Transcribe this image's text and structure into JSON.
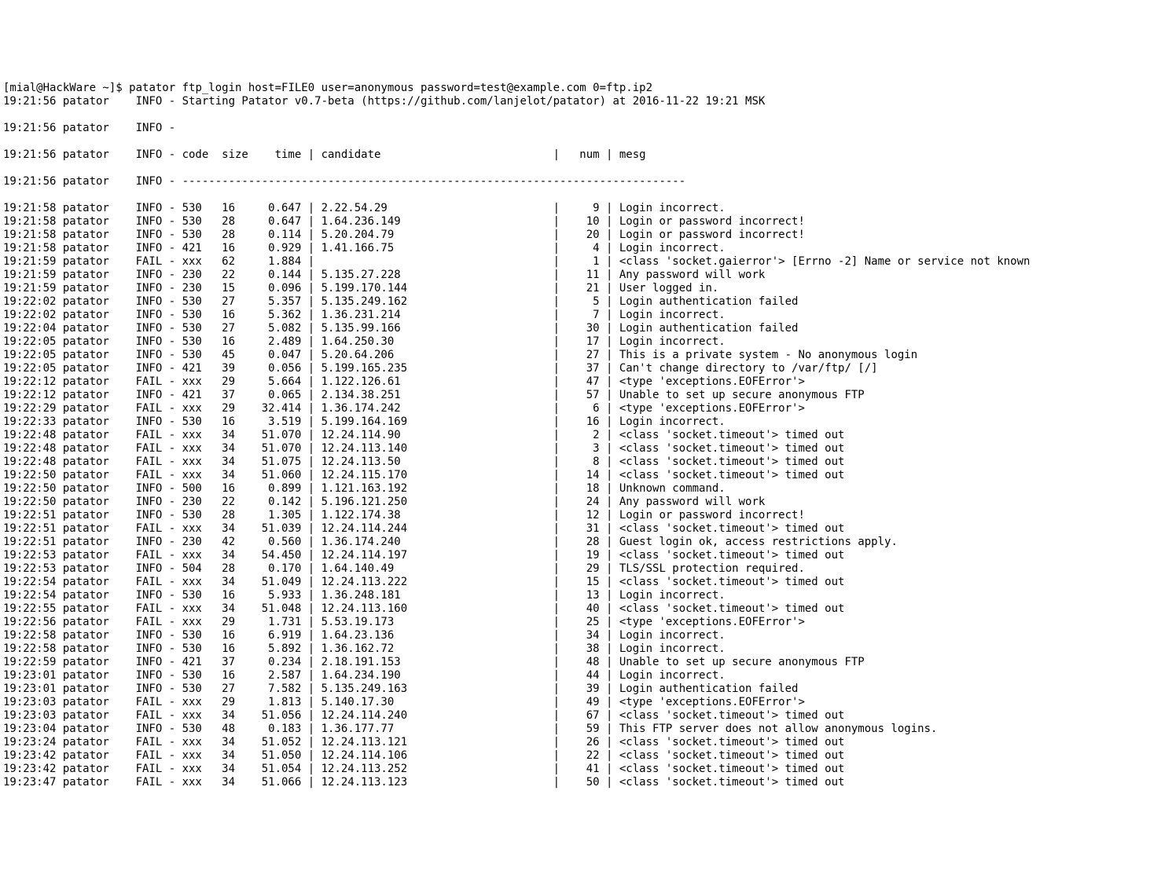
{
  "prompt": "[mial@HackWare ~]$ ",
  "command": "patator ftp_login host=FILE0 user=anonymous password=test@example.com 0=ftp.ip2",
  "startup_line": "19:21:56 patator    INFO - Starting Patator v0.7-beta (https://github.com/lanjelot/patator) at 2016-11-22 19:21 MSK",
  "blank_line": "19:21:56 patator    INFO -",
  "header_line": "19:21:56 patator    INFO - code  size    time | candidate                          |   num | mesg",
  "divider_line": "19:21:56 patator    INFO - ----------------------------------------------------------------------------",
  "rows": [
    {
      "ts": "19:21:58",
      "lvl": "INFO",
      "code": "530",
      "size": "16",
      "time": "0.647",
      "cand": "2.22.54.29",
      "num": "9",
      "mesg": "Login incorrect."
    },
    {
      "ts": "19:21:58",
      "lvl": "INFO",
      "code": "530",
      "size": "28",
      "time": "0.647",
      "cand": "1.64.236.149",
      "num": "10",
      "mesg": "Login or password incorrect!"
    },
    {
      "ts": "19:21:58",
      "lvl": "INFO",
      "code": "530",
      "size": "28",
      "time": "0.114",
      "cand": "5.20.204.79",
      "num": "20",
      "mesg": "Login or password incorrect!"
    },
    {
      "ts": "19:21:58",
      "lvl": "INFO",
      "code": "421",
      "size": "16",
      "time": "0.929",
      "cand": "1.41.166.75",
      "num": "4",
      "mesg": "Login incorrect."
    },
    {
      "ts": "19:21:59",
      "lvl": "FAIL",
      "code": "xxx",
      "size": "62",
      "time": "1.884",
      "cand": "",
      "num": "1",
      "mesg": "<class 'socket.gaierror'> [Errno -2] Name or service not known"
    },
    {
      "ts": "19:21:59",
      "lvl": "INFO",
      "code": "230",
      "size": "22",
      "time": "0.144",
      "cand": "5.135.27.228",
      "num": "11",
      "mesg": "Any password will work"
    },
    {
      "ts": "19:21:59",
      "lvl": "INFO",
      "code": "230",
      "size": "15",
      "time": "0.096",
      "cand": "5.199.170.144",
      "num": "21",
      "mesg": "User logged in."
    },
    {
      "ts": "19:22:02",
      "lvl": "INFO",
      "code": "530",
      "size": "27",
      "time": "5.357",
      "cand": "5.135.249.162",
      "num": "5",
      "mesg": "Login authentication failed"
    },
    {
      "ts": "19:22:02",
      "lvl": "INFO",
      "code": "530",
      "size": "16",
      "time": "5.362",
      "cand": "1.36.231.214",
      "num": "7",
      "mesg": "Login incorrect."
    },
    {
      "ts": "19:22:04",
      "lvl": "INFO",
      "code": "530",
      "size": "27",
      "time": "5.082",
      "cand": "5.135.99.166",
      "num": "30",
      "mesg": "Login authentication failed"
    },
    {
      "ts": "19:22:05",
      "lvl": "INFO",
      "code": "530",
      "size": "16",
      "time": "2.489",
      "cand": "1.64.250.30",
      "num": "17",
      "mesg": "Login incorrect."
    },
    {
      "ts": "19:22:05",
      "lvl": "INFO",
      "code": "530",
      "size": "45",
      "time": "0.047",
      "cand": "5.20.64.206",
      "num": "27",
      "mesg": "This is a private system - No anonymous login"
    },
    {
      "ts": "19:22:05",
      "lvl": "INFO",
      "code": "421",
      "size": "39",
      "time": "0.056",
      "cand": "5.199.165.235",
      "num": "37",
      "mesg": "Can't change directory to /var/ftp/ [/]"
    },
    {
      "ts": "19:22:12",
      "lvl": "FAIL",
      "code": "xxx",
      "size": "29",
      "time": "5.664",
      "cand": "1.122.126.61",
      "num": "47",
      "mesg": "<type 'exceptions.EOFError'>"
    },
    {
      "ts": "19:22:12",
      "lvl": "INFO",
      "code": "421",
      "size": "37",
      "time": "0.065",
      "cand": "2.134.38.251",
      "num": "57",
      "mesg": "Unable to set up secure anonymous FTP"
    },
    {
      "ts": "19:22:29",
      "lvl": "FAIL",
      "code": "xxx",
      "size": "29",
      "time": "32.414",
      "cand": "1.36.174.242",
      "num": "6",
      "mesg": "<type 'exceptions.EOFError'>"
    },
    {
      "ts": "19:22:33",
      "lvl": "INFO",
      "code": "530",
      "size": "16",
      "time": "3.519",
      "cand": "5.199.164.169",
      "num": "16",
      "mesg": "Login incorrect."
    },
    {
      "ts": "19:22:48",
      "lvl": "FAIL",
      "code": "xxx",
      "size": "34",
      "time": "51.070",
      "cand": "12.24.114.90",
      "num": "2",
      "mesg": "<class 'socket.timeout'> timed out"
    },
    {
      "ts": "19:22:48",
      "lvl": "FAIL",
      "code": "xxx",
      "size": "34",
      "time": "51.070",
      "cand": "12.24.113.140",
      "num": "3",
      "mesg": "<class 'socket.timeout'> timed out"
    },
    {
      "ts": "19:22:48",
      "lvl": "FAIL",
      "code": "xxx",
      "size": "34",
      "time": "51.075",
      "cand": "12.24.113.50",
      "num": "8",
      "mesg": "<class 'socket.timeout'> timed out"
    },
    {
      "ts": "19:22:50",
      "lvl": "FAIL",
      "code": "xxx",
      "size": "34",
      "time": "51.060",
      "cand": "12.24.115.170",
      "num": "14",
      "mesg": "<class 'socket.timeout'> timed out"
    },
    {
      "ts": "19:22:50",
      "lvl": "INFO",
      "code": "500",
      "size": "16",
      "time": "0.899",
      "cand": "1.121.163.192",
      "num": "18",
      "mesg": "Unknown command."
    },
    {
      "ts": "19:22:50",
      "lvl": "INFO",
      "code": "230",
      "size": "22",
      "time": "0.142",
      "cand": "5.196.121.250",
      "num": "24",
      "mesg": "Any password will work"
    },
    {
      "ts": "19:22:51",
      "lvl": "INFO",
      "code": "530",
      "size": "28",
      "time": "1.305",
      "cand": "1.122.174.38",
      "num": "12",
      "mesg": "Login or password incorrect!"
    },
    {
      "ts": "19:22:51",
      "lvl": "FAIL",
      "code": "xxx",
      "size": "34",
      "time": "51.039",
      "cand": "12.24.114.244",
      "num": "31",
      "mesg": "<class 'socket.timeout'> timed out"
    },
    {
      "ts": "19:22:51",
      "lvl": "INFO",
      "code": "230",
      "size": "42",
      "time": "0.560",
      "cand": "1.36.174.240",
      "num": "28",
      "mesg": "Guest login ok, access restrictions apply."
    },
    {
      "ts": "19:22:53",
      "lvl": "FAIL",
      "code": "xxx",
      "size": "34",
      "time": "54.450",
      "cand": "12.24.114.197",
      "num": "19",
      "mesg": "<class 'socket.timeout'> timed out"
    },
    {
      "ts": "19:22:53",
      "lvl": "INFO",
      "code": "504",
      "size": "28",
      "time": "0.170",
      "cand": "1.64.140.49",
      "num": "29",
      "mesg": "TLS/SSL protection required."
    },
    {
      "ts": "19:22:54",
      "lvl": "FAIL",
      "code": "xxx",
      "size": "34",
      "time": "51.049",
      "cand": "12.24.113.222",
      "num": "15",
      "mesg": "<class 'socket.timeout'> timed out"
    },
    {
      "ts": "19:22:54",
      "lvl": "INFO",
      "code": "530",
      "size": "16",
      "time": "5.933",
      "cand": "1.36.248.181",
      "num": "13",
      "mesg": "Login incorrect."
    },
    {
      "ts": "19:22:55",
      "lvl": "FAIL",
      "code": "xxx",
      "size": "34",
      "time": "51.048",
      "cand": "12.24.113.160",
      "num": "40",
      "mesg": "<class 'socket.timeout'> timed out"
    },
    {
      "ts": "19:22:56",
      "lvl": "FAIL",
      "code": "xxx",
      "size": "29",
      "time": "1.731",
      "cand": "5.53.19.173",
      "num": "25",
      "mesg": "<type 'exceptions.EOFError'>"
    },
    {
      "ts": "19:22:58",
      "lvl": "INFO",
      "code": "530",
      "size": "16",
      "time": "6.919",
      "cand": "1.64.23.136",
      "num": "34",
      "mesg": "Login incorrect."
    },
    {
      "ts": "19:22:58",
      "lvl": "INFO",
      "code": "530",
      "size": "16",
      "time": "5.892",
      "cand": "1.36.162.72",
      "num": "38",
      "mesg": "Login incorrect."
    },
    {
      "ts": "19:22:59",
      "lvl": "INFO",
      "code": "421",
      "size": "37",
      "time": "0.234",
      "cand": "2.18.191.153",
      "num": "48",
      "mesg": "Unable to set up secure anonymous FTP"
    },
    {
      "ts": "19:23:01",
      "lvl": "INFO",
      "code": "530",
      "size": "16",
      "time": "2.587",
      "cand": "1.64.234.190",
      "num": "44",
      "mesg": "Login incorrect."
    },
    {
      "ts": "19:23:01",
      "lvl": "INFO",
      "code": "530",
      "size": "27",
      "time": "7.582",
      "cand": "5.135.249.163",
      "num": "39",
      "mesg": "Login authentication failed"
    },
    {
      "ts": "19:23:03",
      "lvl": "FAIL",
      "code": "xxx",
      "size": "29",
      "time": "1.813",
      "cand": "5.140.17.30",
      "num": "49",
      "mesg": "<type 'exceptions.EOFError'>"
    },
    {
      "ts": "19:23:03",
      "lvl": "FAIL",
      "code": "xxx",
      "size": "34",
      "time": "51.056",
      "cand": "12.24.114.240",
      "num": "67",
      "mesg": "<class 'socket.timeout'> timed out"
    },
    {
      "ts": "19:23:04",
      "lvl": "INFO",
      "code": "530",
      "size": "48",
      "time": "0.183",
      "cand": "1.36.177.77",
      "num": "59",
      "mesg": "This FTP server does not allow anonymous logins."
    },
    {
      "ts": "19:23:24",
      "lvl": "FAIL",
      "code": "xxx",
      "size": "34",
      "time": "51.052",
      "cand": "12.24.113.121",
      "num": "26",
      "mesg": "<class 'socket.timeout'> timed out"
    },
    {
      "ts": "19:23:42",
      "lvl": "FAIL",
      "code": "xxx",
      "size": "34",
      "time": "51.050",
      "cand": "12.24.114.106",
      "num": "22",
      "mesg": "<class 'socket.timeout'> timed out"
    },
    {
      "ts": "19:23:42",
      "lvl": "FAIL",
      "code": "xxx",
      "size": "34",
      "time": "51.054",
      "cand": "12.24.113.252",
      "num": "41",
      "mesg": "<class 'socket.timeout'> timed out"
    },
    {
      "ts": "19:23:47",
      "lvl": "FAIL",
      "code": "xxx",
      "size": "34",
      "time": "51.066",
      "cand": "12.24.113.123",
      "num": "50",
      "mesg": "<class 'socket.timeout'> timed out"
    }
  ]
}
